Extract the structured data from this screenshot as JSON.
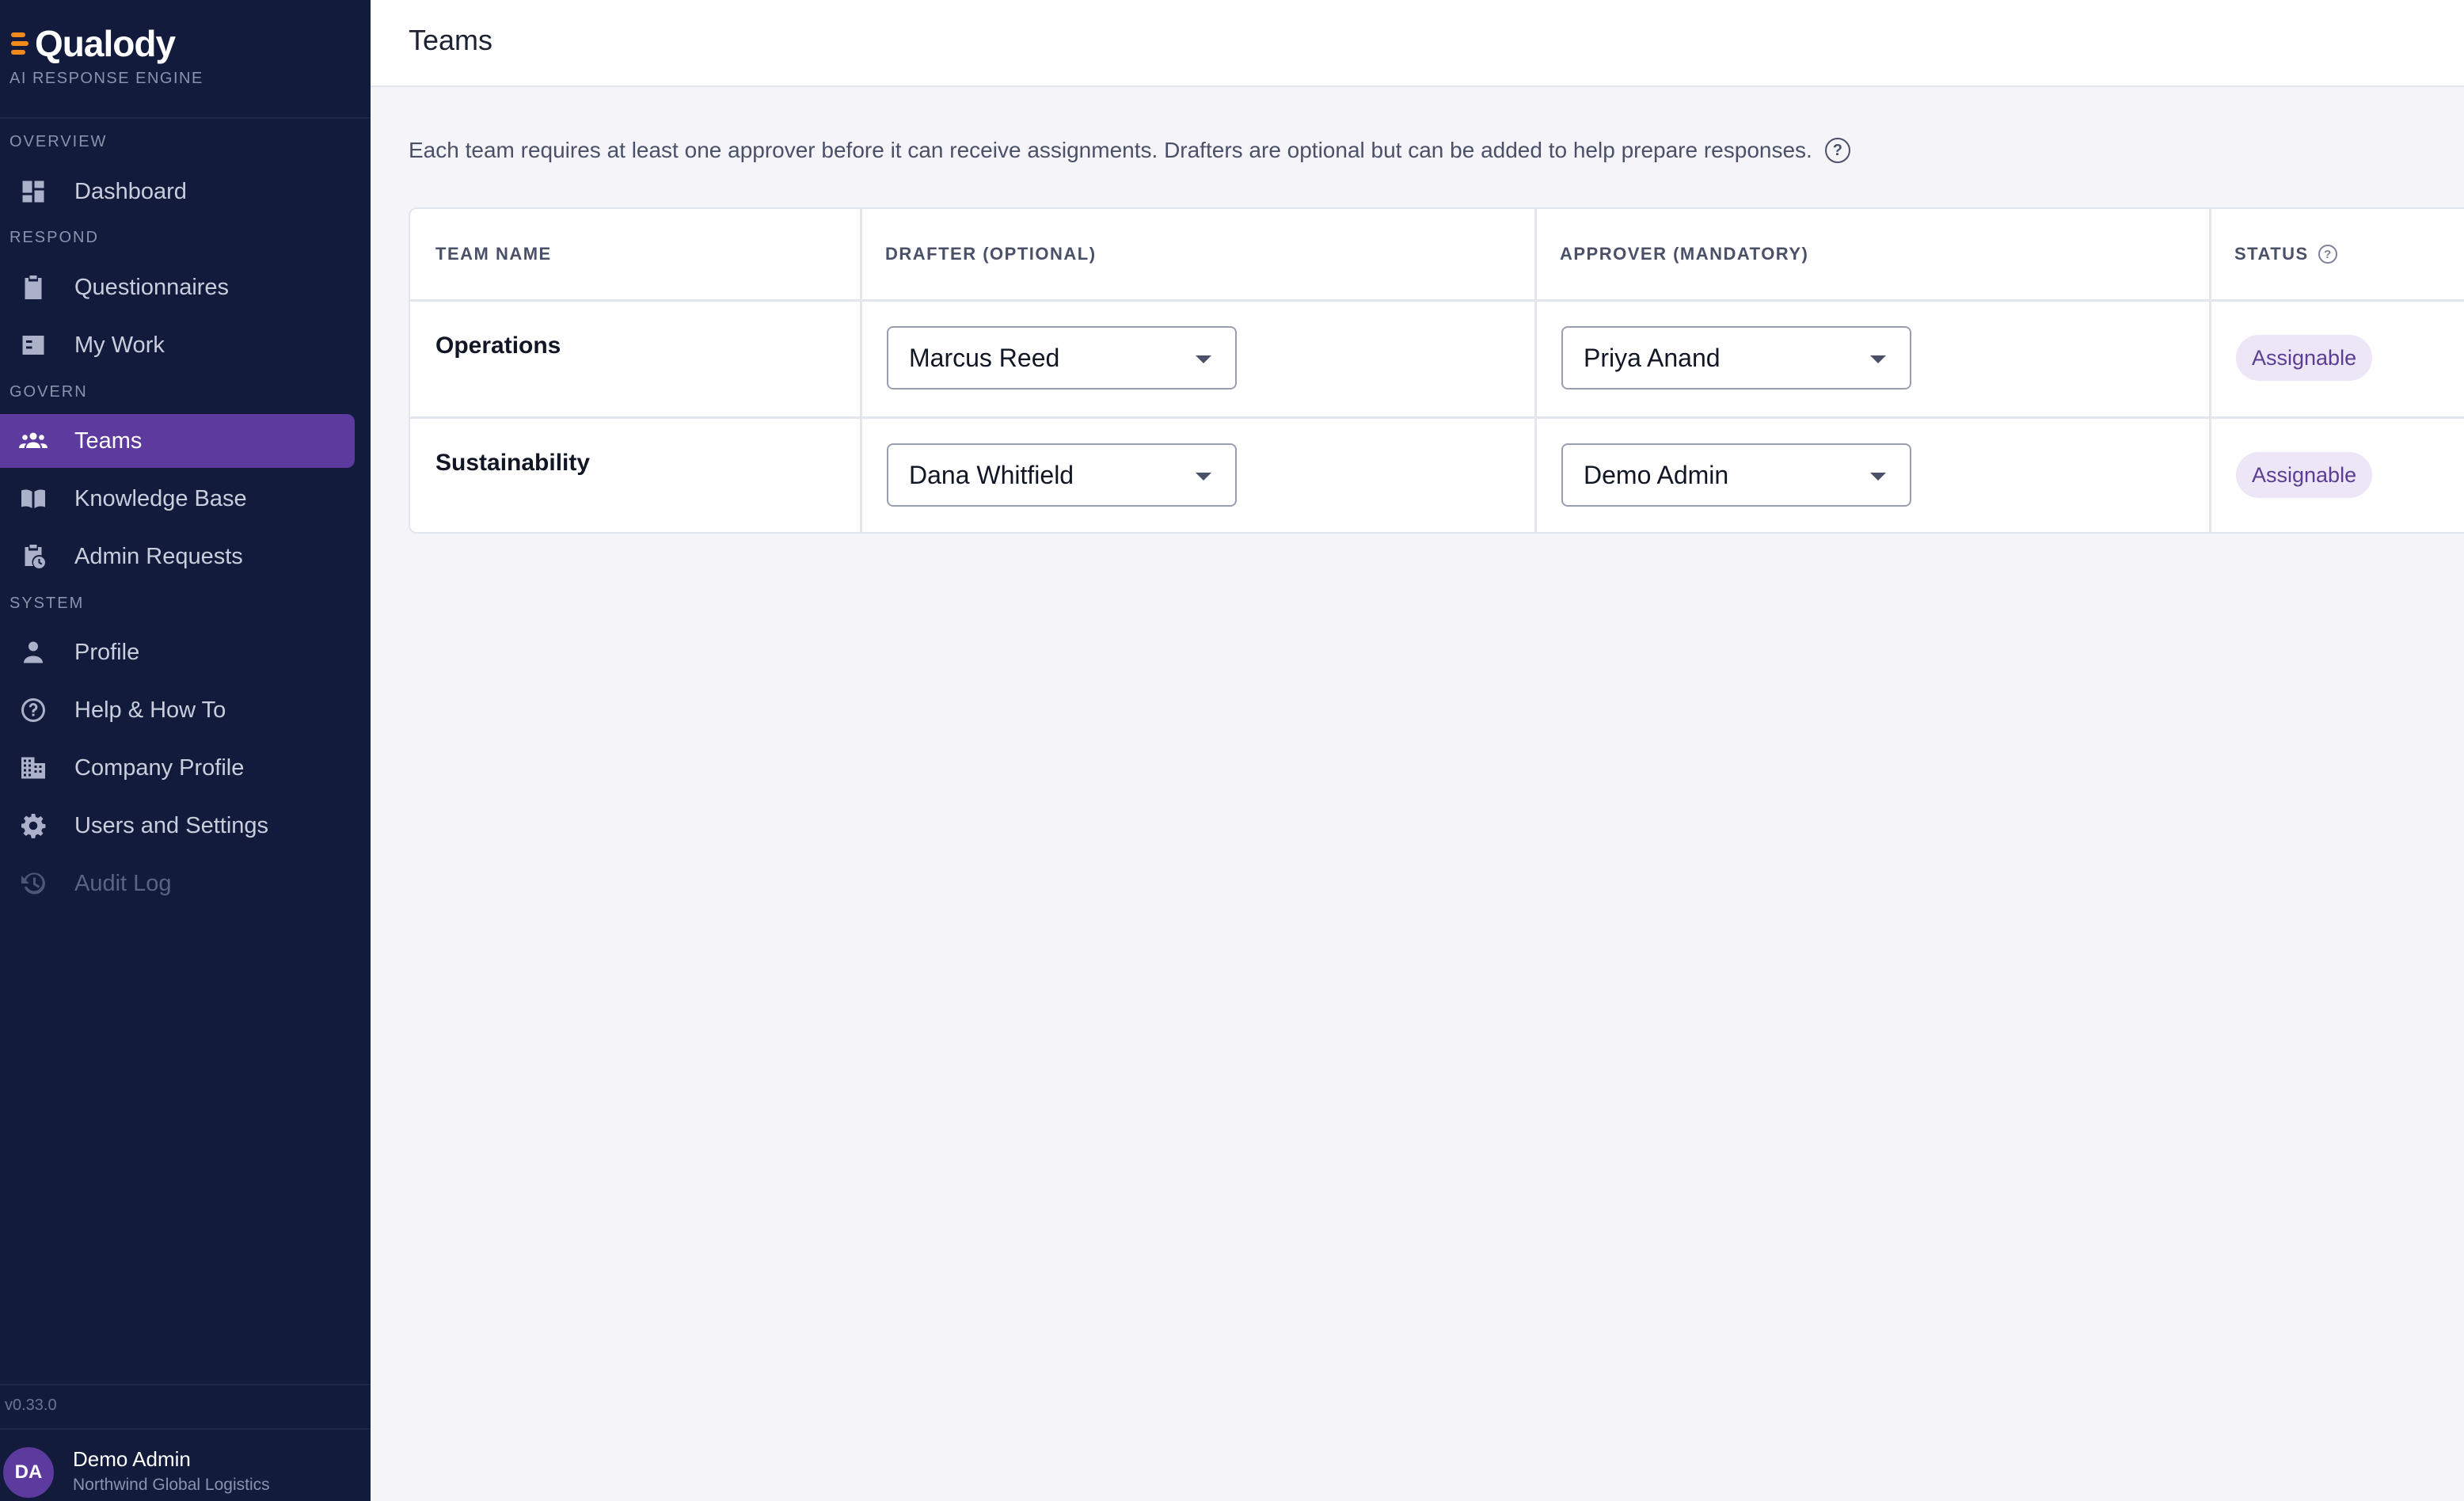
{
  "app": {
    "logo_text": "Qualody",
    "tagline": "AI RESPONSE ENGINE",
    "version": "v0.33.0"
  },
  "sidebar": {
    "sections": {
      "overview": "OVERVIEW",
      "respond": "RESPOND",
      "govern": "GOVERN",
      "system": "SYSTEM"
    },
    "items": {
      "dashboard": "Dashboard",
      "questionnaires": "Questionnaires",
      "my_work": "My Work",
      "teams": "Teams",
      "knowledge_base": "Knowledge Base",
      "admin_requests": "Admin Requests",
      "profile": "Profile",
      "help": "Help & How To",
      "company_profile": "Company Profile",
      "users_settings": "Users and Settings",
      "audit_log": "Audit Log"
    },
    "active_item": "teams",
    "disabled_items": [
      "audit_log"
    ]
  },
  "user": {
    "initials": "DA",
    "name": "Demo Admin",
    "org": "Northwind Global Logistics"
  },
  "page": {
    "title": "Teams",
    "info": "Each team requires at least one approver before it can receive assignments. Drafters are optional but can be added to help prepare responses.",
    "info_icon": "?"
  },
  "table": {
    "headers": {
      "team_name": "TEAM NAME",
      "drafter": "DRAFTER (OPTIONAL)",
      "approver": "APPROVER (MANDATORY)",
      "status": "STATUS"
    },
    "status_help_icon": "?",
    "rows": [
      {
        "team": "Operations",
        "drafter": "Marcus Reed",
        "approver": "Priya Anand",
        "status": "Assignable"
      },
      {
        "team": "Sustainability",
        "drafter": "Dana Whitfield",
        "approver": "Demo Admin",
        "status": "Assignable"
      }
    ]
  },
  "colors": {
    "sidebar_bg": "#121b3c",
    "active_nav": "#5d3a9e",
    "logo_accent": "#f28a1b",
    "badge_bg": "#ece6f6",
    "badge_text": "#5b3d93",
    "page_bg": "#f5f5f9"
  }
}
